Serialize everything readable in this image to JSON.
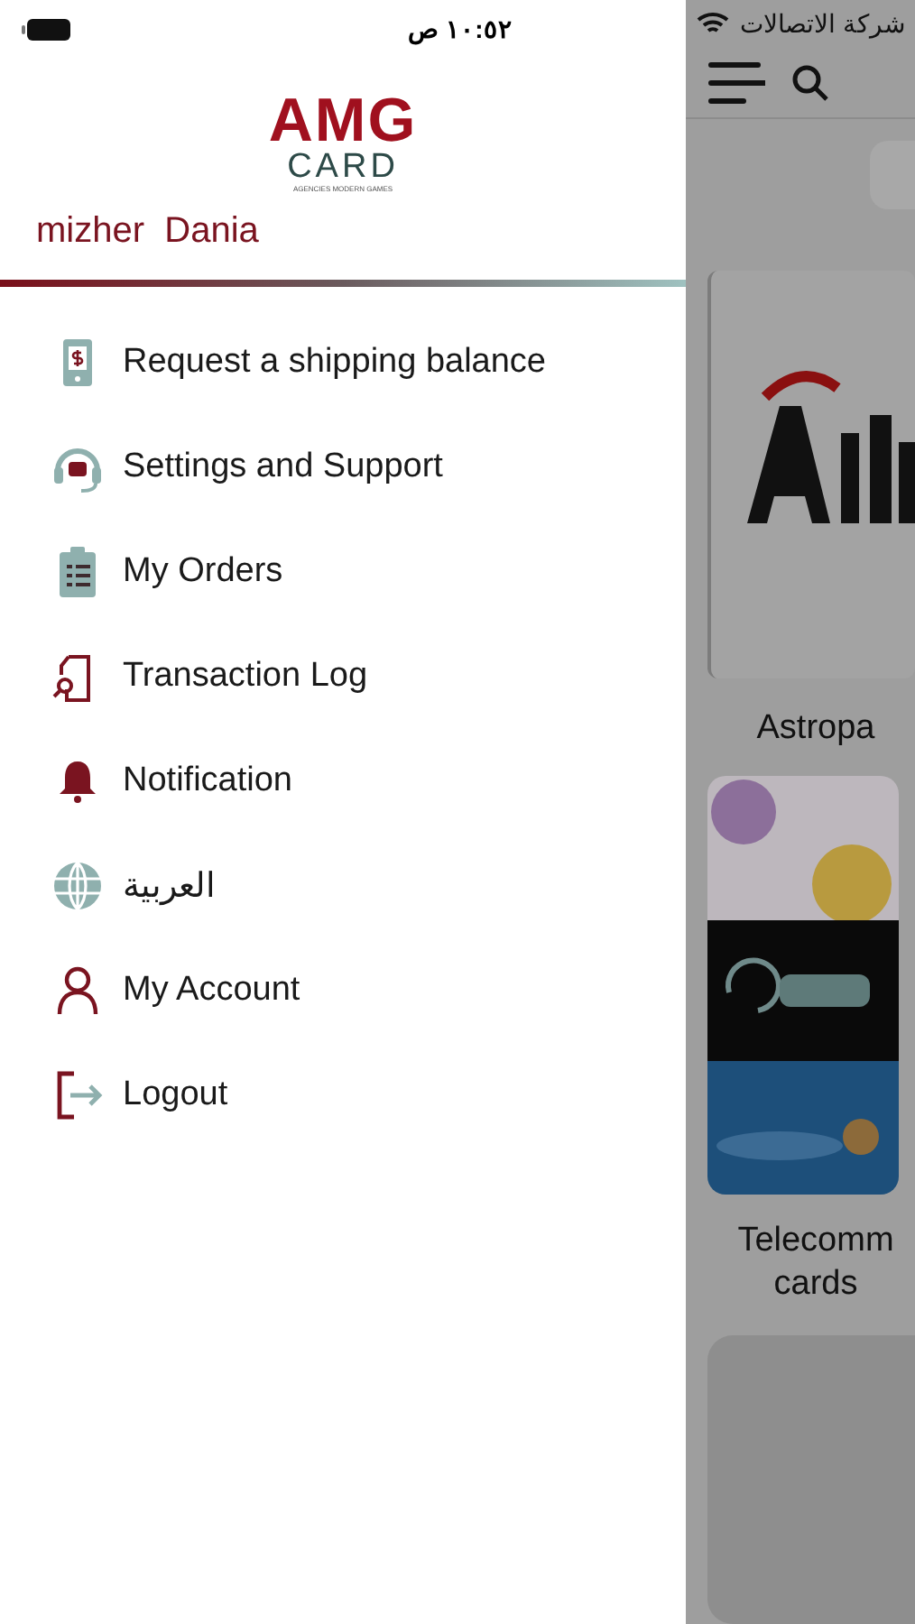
{
  "status_bar": {
    "time": "١٠:٥٢ ص",
    "carrier": "شركة الاتصالات"
  },
  "drawer": {
    "logo": {
      "mark": "AMG",
      "word": "CARD",
      "tagline": "AGENCIES MODERN GAMES"
    },
    "user_name": "mizher  Dania",
    "items": [
      {
        "kind": "balance",
        "label": "Request a shipping balance"
      },
      {
        "kind": "support",
        "label": "Settings and Support"
      },
      {
        "kind": "orders",
        "label": "My Orders"
      },
      {
        "kind": "log",
        "label": "Transaction Log"
      },
      {
        "kind": "bell",
        "label": "Notification"
      },
      {
        "kind": "globe",
        "label": "العربية"
      },
      {
        "kind": "account",
        "label": "My Account"
      },
      {
        "kind": "logout",
        "label": "Logout"
      }
    ]
  },
  "background_page": {
    "cards": [
      {
        "kind": "astro",
        "label": "Astropa"
      },
      {
        "kind": "telecom",
        "label": "Telecomm\ncards"
      },
      {
        "kind": "blank"
      }
    ]
  }
}
